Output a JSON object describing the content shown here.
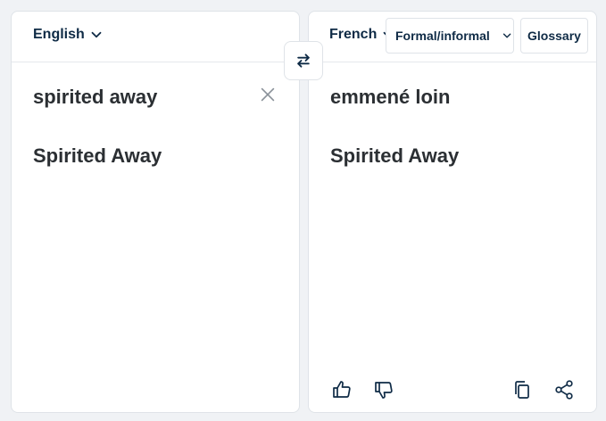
{
  "source": {
    "language": "English",
    "text_lines": [
      "spirited away",
      "",
      "Spirited Away"
    ]
  },
  "target": {
    "language": "French",
    "formality_label": "Formal/informal",
    "glossary_label": "Glossary",
    "text_lines": [
      "emmené loin",
      "",
      "Spirited Away"
    ]
  },
  "icons": {
    "chevron": "chevron-down-icon",
    "swap": "swap-arrows-icon",
    "clear": "close-icon",
    "thumbs_up": "thumbs-up-icon",
    "thumbs_down": "thumbs-down-icon",
    "copy": "copy-icon",
    "share": "share-icon"
  },
  "colors": {
    "accent": "#0f2b46",
    "text": "#2b2f33",
    "background": "#f0f2f5",
    "border": "#dfe3e8"
  }
}
